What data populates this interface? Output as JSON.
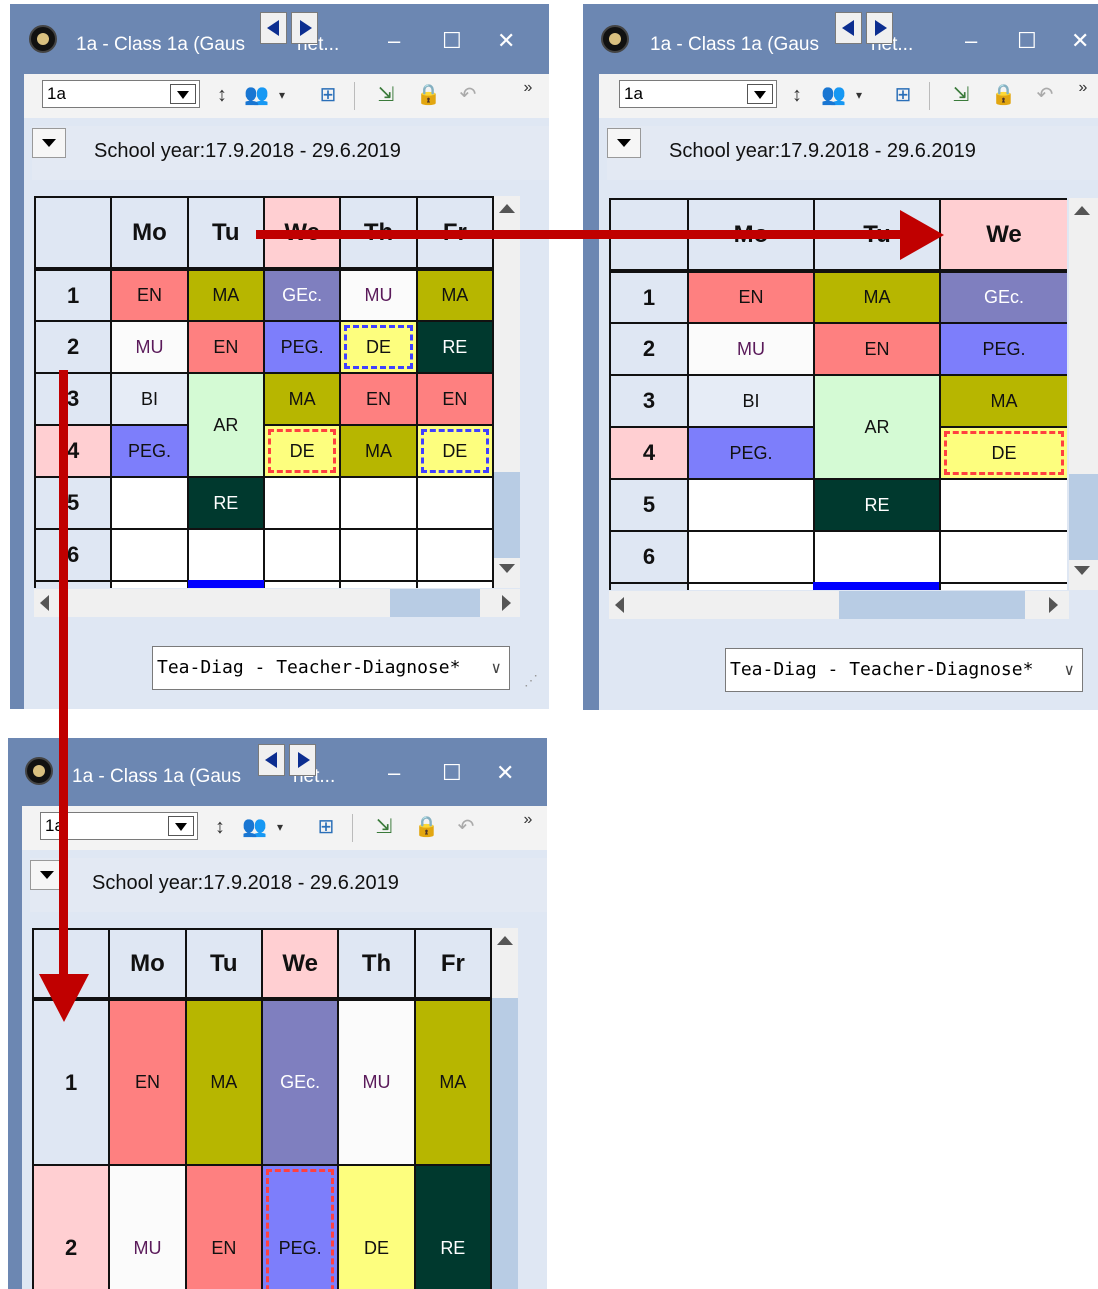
{
  "windows": [
    {
      "title": "1a - Class 1a (Gaus",
      "title_tail": "het...",
      "class_value": "1a",
      "period_label": "School year:17.9.2018 - 29.6.2019",
      "format_value": "Tea-Diag - Teacher-Diagnose*"
    },
    {
      "title": "1a - Class 1a (Gaus",
      "title_tail": "het...",
      "class_value": "1a",
      "period_label": "School year:17.9.2018 - 29.6.2019",
      "format_value": "Tea-Diag - Teacher-Diagnose*"
    },
    {
      "title": "1a - Class 1a (Gaus",
      "title_tail": "het...",
      "class_value": "1a",
      "period_label": "School year:17.9.2018 - 29.6.2019"
    }
  ],
  "window_controls": {
    "minimize": "–",
    "maximize": "☐",
    "close": "✕"
  },
  "toolbar_overflow": "»",
  "days": [
    "Mo",
    "Tu",
    "We",
    "Th",
    "Fr"
  ],
  "periods": [
    "1",
    "2",
    "3",
    "4",
    "5",
    "6"
  ],
  "lessons": {
    "mo1": "EN",
    "tu1": "MA",
    "we1": "GEc.",
    "th1": "MU",
    "fr1": "MA",
    "mo2": "MU",
    "tu2": "EN",
    "we2": "PEG.",
    "th2": "DE",
    "fr2": "RE",
    "mo3": "BI",
    "tu34": "AR",
    "we3": "MA",
    "th3": "EN",
    "fr3": "EN",
    "mo4": "PEG.",
    "we4": "DE",
    "th4": "MA",
    "fr4": "DE",
    "tu5": "RE"
  },
  "colors": {
    "EN": "#fe8080",
    "MA": "#b7b600",
    "GEc": "#7f7fbf",
    "MU": "#fbfbfb",
    "PEG": "#7d7efb",
    "RE": "#00392e",
    "BI": "#e6ecf6",
    "AR": "#d4fad4",
    "DE": "#fdfe7e",
    "highlight": "#ffcfd2",
    "arrow": "#c00000",
    "titlebar": "#6c87b2"
  }
}
